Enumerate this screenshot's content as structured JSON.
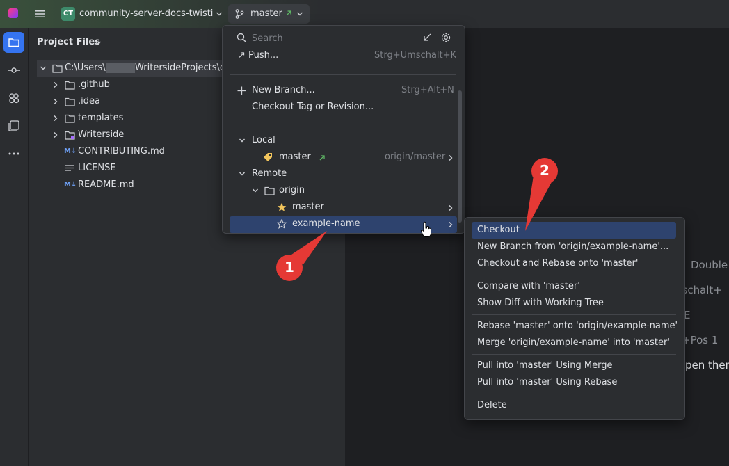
{
  "titlebar": {
    "project_badge": "CT",
    "project_name": "community-server-docs-twisti",
    "branch": "master",
    "logo_colors": [
      "#ff3b7f",
      "#7b3bff"
    ]
  },
  "toolstrip": {
    "icons": [
      "folder-icon",
      "commit-icon",
      "structure-icon",
      "layers-icon",
      "more-icon"
    ]
  },
  "project_panel": {
    "title": "Project Files",
    "root": {
      "prefix": "C:\\Users\\",
      "suffix": "WritersideProjects\\c"
    },
    "items": [
      {
        "label": ".github",
        "kind": "folder"
      },
      {
        "label": ".idea",
        "kind": "folder"
      },
      {
        "label": "templates",
        "kind": "folder"
      },
      {
        "label": "Writerside",
        "kind": "writerside-folder"
      },
      {
        "label": "CONTRIBUTING.md",
        "kind": "md"
      },
      {
        "label": "LICENSE",
        "kind": "text"
      },
      {
        "label": "README.md",
        "kind": "md"
      }
    ],
    "md_badge": "M↓"
  },
  "editor_hints": [
    "Double",
    "nschalt+",
    "E",
    "+Pos 1",
    "pen them"
  ],
  "branch_popup": {
    "search_placeholder": "Search",
    "push": {
      "label": "Push...",
      "shortcut": "Strg+Umschalt+K"
    },
    "new_branch": {
      "label": "New Branch...",
      "shortcut": "Strg+Alt+N"
    },
    "checkout_tag": "Checkout Tag or Revision...",
    "local_header": "Local",
    "local_branch": {
      "name": "master",
      "tracking": "origin/master"
    },
    "remote_header": "Remote",
    "remote_group": "origin",
    "remote_branches": [
      "master",
      "example-name"
    ]
  },
  "context_menu": {
    "items": [
      "Checkout",
      "New Branch from 'origin/example-name'...",
      "Checkout and Rebase onto 'master'",
      "Compare with 'master'",
      "Show Diff with Working Tree",
      "Rebase 'master' onto 'origin/example-name'",
      "Merge 'origin/example-name' into 'master'",
      "Pull into 'master' Using Merge",
      "Pull into 'master' Using Rebase",
      "Delete"
    ]
  },
  "callouts": [
    "1",
    "2"
  ],
  "colors": {
    "accent": "#3574f0",
    "selection": "#2e436e",
    "callout": "#e53935",
    "star": "#f2c55c"
  }
}
